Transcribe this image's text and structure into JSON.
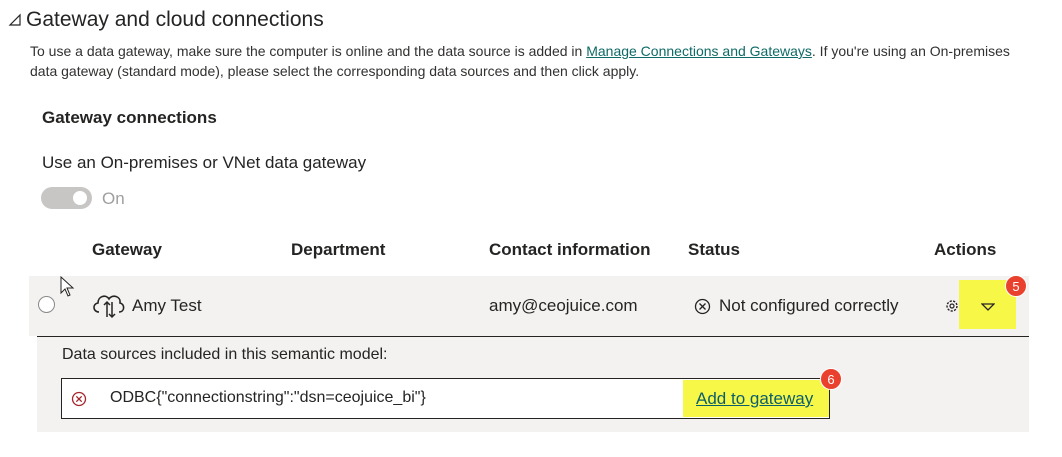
{
  "section": {
    "title": "Gateway and cloud connections",
    "description_before": "To use a data gateway, make sure the computer is online and the data source is added in ",
    "description_link": "Manage Connections and Gateways",
    "description_after": ". If you're using an On-premises data gateway (standard mode), please select the corresponding data sources and then click apply."
  },
  "gateway_connections": {
    "title": "Gateway connections",
    "toggle_label": "Use an On-premises or VNet data gateway",
    "toggle_state": "On"
  },
  "table": {
    "headers": {
      "gateway": "Gateway",
      "department": "Department",
      "contact": "Contact information",
      "status": "Status",
      "actions": "Actions"
    },
    "row": {
      "gateway": "Amy Test",
      "department": "",
      "contact": "amy@ceojuice.com",
      "status": "Not configured correctly"
    }
  },
  "data_sources": {
    "label": "Data sources included in this semantic model:",
    "items": [
      {
        "name": "ODBC{\"connectionstring\":\"dsn=ceojuice_bi\"}",
        "action": "Add to gateway"
      }
    ]
  },
  "annotations": {
    "badge_dropdown": "5",
    "badge_add": "6"
  },
  "colors": {
    "link": "#0e6a66",
    "highlight": "#f7f748",
    "badge": "#e9412d",
    "row_bg": "#f3f2f1"
  },
  "icons": {
    "collapse": "triangle-collapse-icon",
    "cloud": "cloud-gateway-icon",
    "status": "error-circle-icon",
    "gear": "gear-icon",
    "dropdown": "chevron-down-icon",
    "ds_error": "error-circle-icon"
  }
}
